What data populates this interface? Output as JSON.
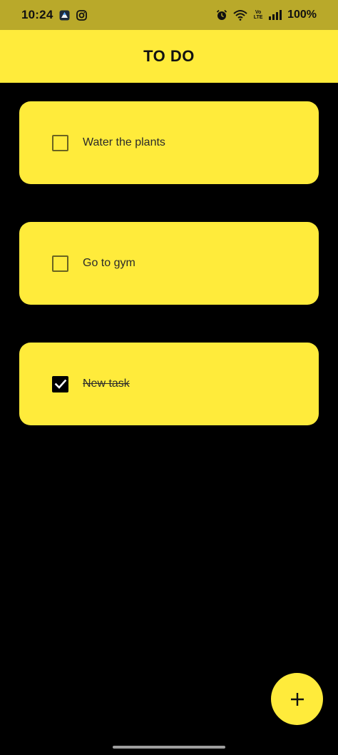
{
  "status_bar": {
    "time": "10:24",
    "battery": "100%",
    "volte_top": "Vo",
    "volte_bottom": "LTE",
    "icons": [
      "drive-icon",
      "instagram-icon",
      "alarm-icon",
      "wifi-icon",
      "volte-icon",
      "signal-icon"
    ]
  },
  "app_bar": {
    "title": "TO DO"
  },
  "tasks": [
    {
      "label": "Water the plants",
      "checked": false
    },
    {
      "label": "Go to gym",
      "checked": false
    },
    {
      "label": "New task",
      "checked": true
    }
  ],
  "fab": {
    "icon": "plus-icon",
    "symbol": "+"
  },
  "colors": {
    "status_bar_bg": "#b9a92a",
    "accent": "#ffeb3b",
    "background": "#000000"
  }
}
